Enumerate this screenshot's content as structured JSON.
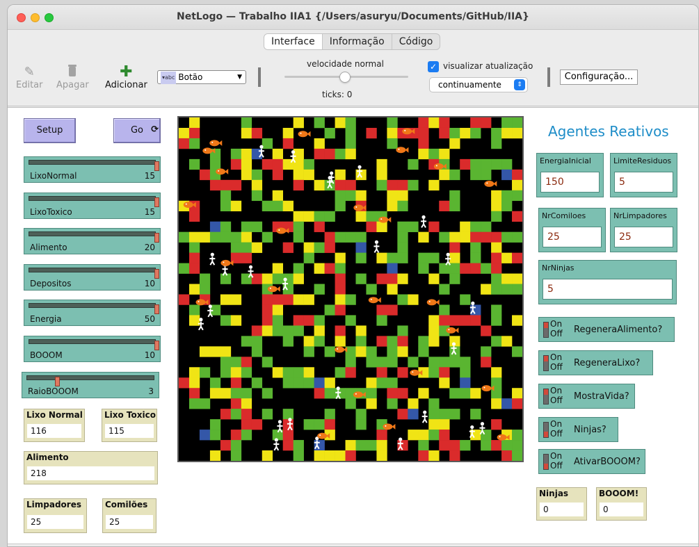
{
  "window": {
    "title": "NetLogo — Trabalho IIA1 {/Users/asuryu/Documents/GitHub/IIA}",
    "tabs": [
      {
        "label": "Interface",
        "active": true
      },
      {
        "label": "Informação",
        "active": false
      },
      {
        "label": "Código",
        "active": false
      }
    ]
  },
  "toolbar": {
    "edit_label": "Editar",
    "delete_label": "Apagar",
    "add_label": "Adicionar",
    "widget_type": "Botão",
    "speed_label": "velocidade normal",
    "speed_fraction": 0.5,
    "ticks_label": "ticks: 0",
    "view_updates_label": "visualizar atualização",
    "view_updates_checked": true,
    "update_mode": "continuamente",
    "settings_label": "Configuração..."
  },
  "buttons": {
    "setup": "Setup",
    "go": "Go"
  },
  "sliders": [
    {
      "name": "LixoNormal",
      "value": "15",
      "fraction": 1.0
    },
    {
      "name": "LixoToxico",
      "value": "15",
      "fraction": 1.0
    },
    {
      "name": "Alimento",
      "value": "20",
      "fraction": 1.0
    },
    {
      "name": "Depositos",
      "value": "10",
      "fraction": 1.0
    },
    {
      "name": "Energia",
      "value": "50",
      "fraction": 1.0
    },
    {
      "name": "BOOOM",
      "value": "10",
      "fraction": 1.0
    },
    {
      "name": "RaioBOOOM",
      "value": "3",
      "fraction": 0.25
    }
  ],
  "monitors": {
    "lixo_normal": {
      "label": "Lixo Normal",
      "value": "116"
    },
    "lixo_toxico": {
      "label": "Lixo Toxico",
      "value": "115"
    },
    "alimento": {
      "label": "Alimento",
      "value": "218"
    },
    "limpadores": {
      "label": "Limpadores",
      "value": "25"
    },
    "comiloes": {
      "label": "Comilões",
      "value": "25"
    },
    "ninjas": {
      "label": "Ninjas",
      "value": "0"
    },
    "booom": {
      "label": "BOOOM!",
      "value": "0"
    }
  },
  "heading": "Agentes Reativos",
  "inputs": {
    "energia_inicial": {
      "label": "EnergiaInicial",
      "value": "150"
    },
    "limite_residuos": {
      "label": "LimiteResiduos",
      "value": "5"
    },
    "nr_comiloes": {
      "label": "NrComiloes",
      "value": "25"
    },
    "nr_limpadores": {
      "label": "NrLimpadores",
      "value": "25"
    },
    "nr_ninjas": {
      "label": "NrNinjas",
      "value": "5"
    }
  },
  "switch_on_label": "On",
  "switch_off_label": "Off",
  "switches": [
    {
      "name": "RegeneraAlimento?",
      "on": true
    },
    {
      "name": "RegeneraLixo?",
      "on": true
    },
    {
      "name": "MostraVida?",
      "on": true
    },
    {
      "name": "Ninjas?",
      "on": false
    },
    {
      "name": "AtivarBOOOM?",
      "on": false
    }
  ],
  "world": {
    "patch_colors": {
      "empty": "#000000",
      "lixo_normal": "#f0e415",
      "lixo_toxico": "#da2b2b",
      "alimento": "#5ab531",
      "deposito": "#3457a8"
    },
    "agent_colors": {
      "limpador": "#ffffff",
      "comilao": "#f07818"
    }
  }
}
